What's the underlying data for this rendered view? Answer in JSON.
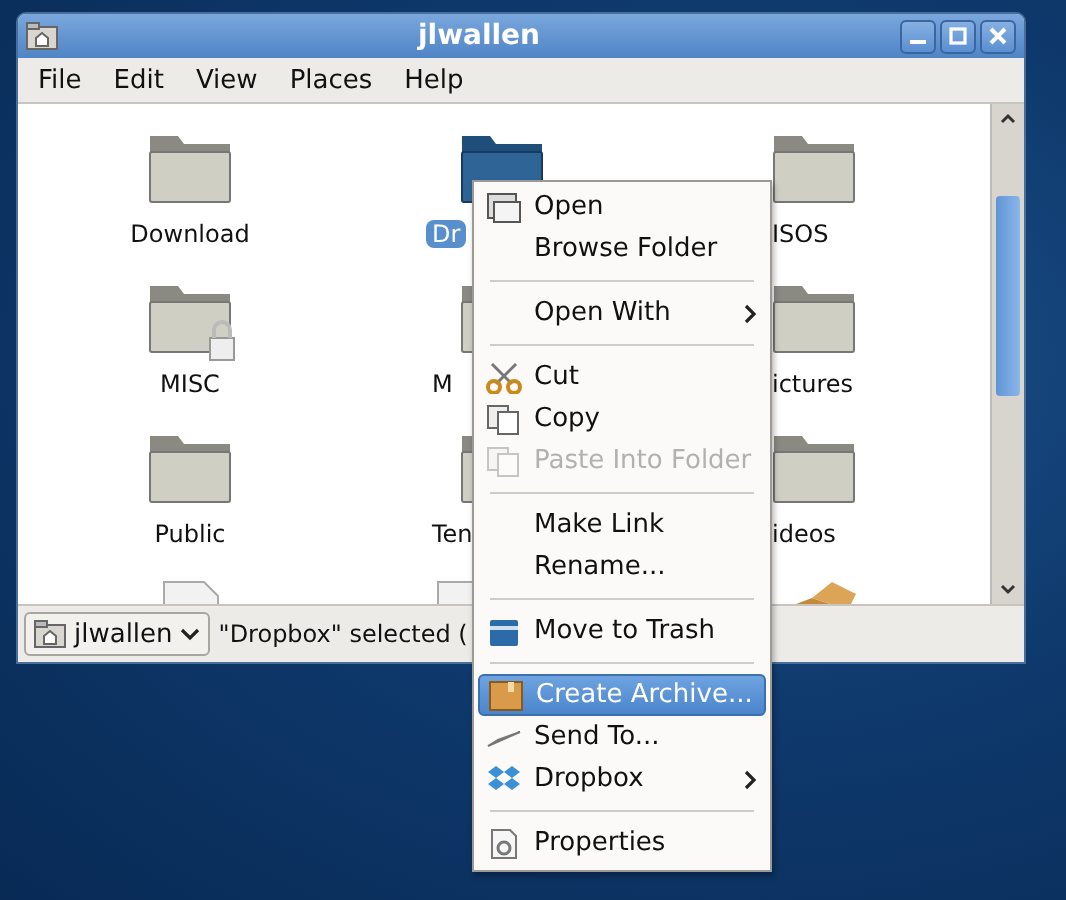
{
  "window": {
    "title": "jlwallen"
  },
  "menu_bar": [
    "File",
    "Edit",
    "View",
    "Places",
    "Help"
  ],
  "files": [
    {
      "label": "Download",
      "kind": "folder",
      "selected": false
    },
    {
      "label": "Dr",
      "kind": "dropbox-folder",
      "selected": true
    },
    {
      "label": "ISOS",
      "kind": "folder",
      "selected": false
    },
    {
      "label": "MISC",
      "kind": "locked-folder",
      "selected": false
    },
    {
      "label": "M",
      "kind": "folder",
      "selected": false
    },
    {
      "label": "ictures",
      "kind": "folder",
      "selected": false
    },
    {
      "label": "Public",
      "kind": "folder",
      "selected": false
    },
    {
      "label": "Ten",
      "kind": "folder",
      "selected": false
    },
    {
      "label": "ideos",
      "kind": "folder",
      "selected": false
    },
    {
      "kind": "document",
      "selected": false
    },
    {
      "kind": "document",
      "selected": false
    },
    {
      "kind": "package",
      "selected": false
    }
  ],
  "status_bar": {
    "location": "jlwallen",
    "message": "\"Dropbox\" selected ("
  },
  "context_menu": [
    {
      "kind": "open",
      "label": "Open",
      "selected": false,
      "disabled": false,
      "submenu": false
    },
    {
      "kind": "plain",
      "label": "Browse Folder",
      "selected": false,
      "disabled": false,
      "submenu": false
    },
    {
      "kind": "separator"
    },
    {
      "kind": "plain",
      "label": "Open With",
      "selected": false,
      "disabled": false,
      "submenu": true
    },
    {
      "kind": "separator"
    },
    {
      "kind": "cut",
      "label": "Cut",
      "selected": false,
      "disabled": false,
      "submenu": false
    },
    {
      "kind": "copy",
      "label": "Copy",
      "selected": false,
      "disabled": false,
      "submenu": false
    },
    {
      "kind": "paste",
      "label": "Paste Into Folder",
      "selected": false,
      "disabled": true,
      "submenu": false
    },
    {
      "kind": "separator"
    },
    {
      "kind": "plain",
      "label": "Make Link",
      "selected": false,
      "disabled": false,
      "submenu": false
    },
    {
      "kind": "plain",
      "label": "Rename...",
      "selected": false,
      "disabled": false,
      "submenu": false
    },
    {
      "kind": "separator"
    },
    {
      "kind": "trash",
      "label": "Move to Trash",
      "selected": false,
      "disabled": false,
      "submenu": false
    },
    {
      "kind": "separator"
    },
    {
      "kind": "archive",
      "label": "Create Archive...",
      "selected": true,
      "disabled": false,
      "submenu": false
    },
    {
      "kind": "send",
      "label": "Send To...",
      "selected": false,
      "disabled": false,
      "submenu": false
    },
    {
      "kind": "dropbox",
      "label": "Dropbox",
      "selected": false,
      "disabled": false,
      "submenu": true
    },
    {
      "kind": "separator"
    },
    {
      "kind": "properties",
      "label": "Properties",
      "selected": false,
      "disabled": false,
      "submenu": false
    }
  ]
}
